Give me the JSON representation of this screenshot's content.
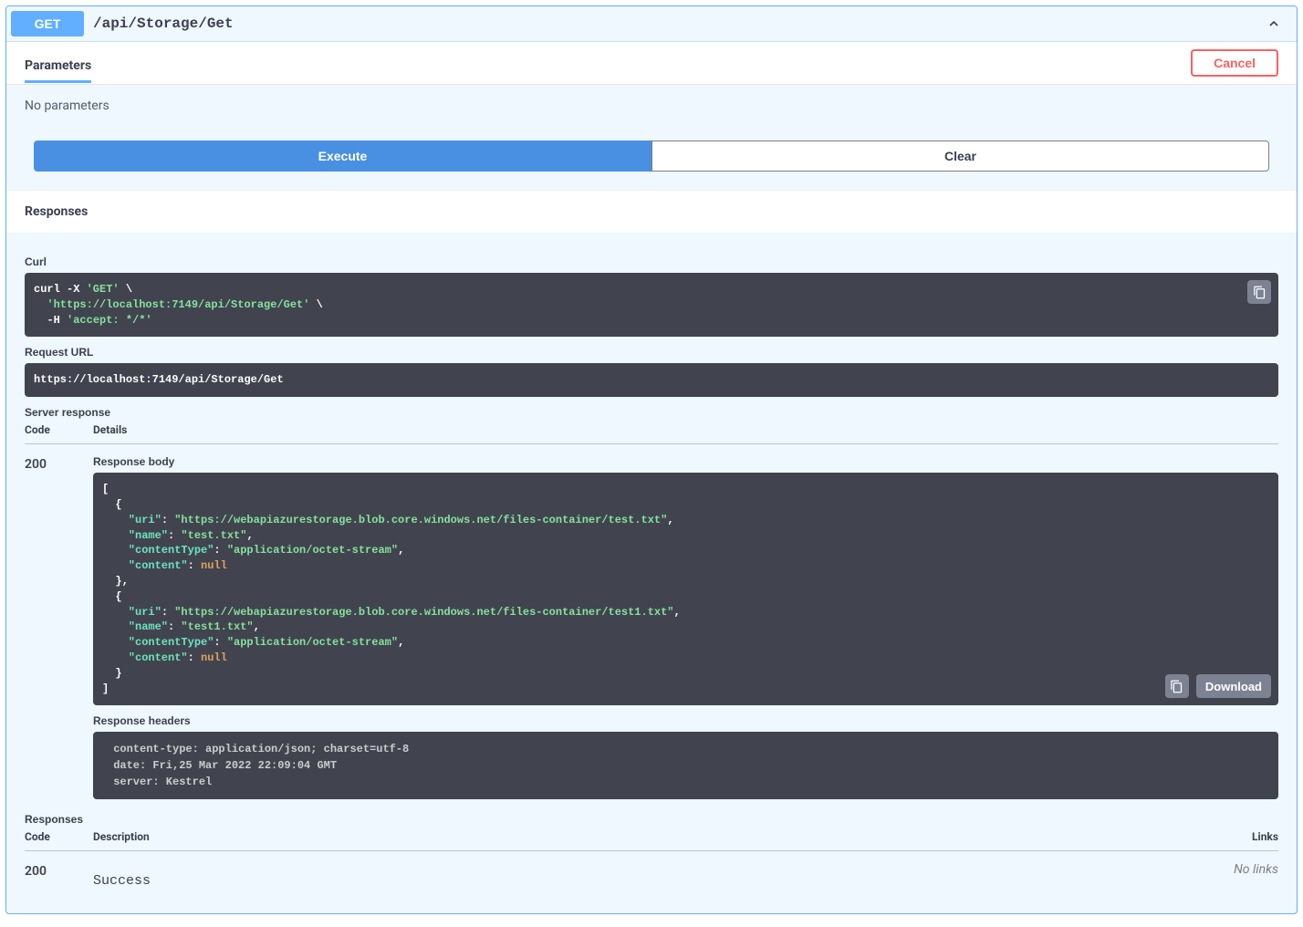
{
  "operation": {
    "method": "GET",
    "path": "/api/Storage/Get"
  },
  "tabs": {
    "parameters": "Parameters",
    "cancel": "Cancel"
  },
  "noParameters": "No parameters",
  "buttons": {
    "execute": "Execute",
    "clear": "Clear",
    "download": "Download"
  },
  "sections": {
    "responses": "Responses",
    "curl": "Curl",
    "requestUrl": "Request URL",
    "serverResponse": "Server response",
    "responseBody": "Response body",
    "responseHeaders": "Response headers",
    "responsesLower": "Responses"
  },
  "curl": {
    "line1": "curl -X ",
    "method": "'GET'",
    "slash1": " \\",
    "url": "'https://localhost:7149/api/Storage/Get'",
    "slash2": " \\",
    "hflag": "  -H ",
    "header": "'accept: */*'"
  },
  "requestUrl": "https://localhost:7149/api/Storage/Get",
  "table": {
    "codeHeader": "Code",
    "detailsHeader": "Details",
    "descHeader": "Description",
    "linksHeader": "Links"
  },
  "serverResp": {
    "code": "200"
  },
  "responseBody": {
    "open": "[",
    "obj1open": "  {",
    "uri1key": "    \"uri\"",
    "uri1val": "\"https://webapiazurestorage.blob.core.windows.net/files-container/test.txt\"",
    "name1key": "    \"name\"",
    "name1val": "\"test.txt\"",
    "ct1key": "    \"contentType\"",
    "ct1val": "\"application/octet-stream\"",
    "content1key": "    \"content\"",
    "content1val": "null",
    "obj1close": "  },",
    "obj2open": "  {",
    "uri2key": "    \"uri\"",
    "uri2val": "\"https://webapiazurestorage.blob.core.windows.net/files-container/test1.txt\"",
    "name2key": "    \"name\"",
    "name2val": "\"test1.txt\"",
    "ct2key": "    \"contentType\"",
    "ct2val": "\"application/octet-stream\"",
    "content2key": "    \"content\"",
    "content2val": "null",
    "obj2close": "  }",
    "close": "]"
  },
  "responseHeaders": " content-type: application/json; charset=utf-8 \n date: Fri,25 Mar 2022 22:09:04 GMT \n server: Kestrel ",
  "docResponses": {
    "code": "200",
    "desc": "Success",
    "noLinks": "No links"
  }
}
